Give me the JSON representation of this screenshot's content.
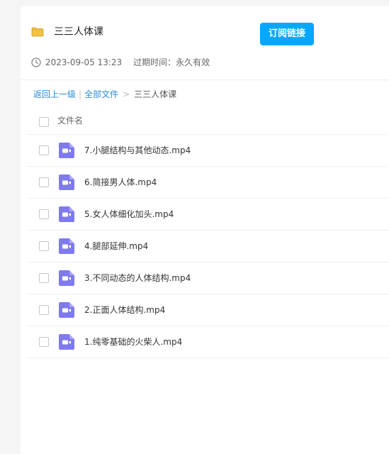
{
  "header": {
    "folder_icon": "folder-icon",
    "title": "三三人体课",
    "subscribe_label": "订阅链接",
    "subscribe_color": "#06a7ff",
    "date": "2023-09-05 13:23",
    "expiry": "过期时间：永久有效"
  },
  "breadcrumb": {
    "back_label": "返回上一级",
    "all_files_label": "全部文件",
    "current_label": "三三人体课"
  },
  "list": {
    "column_label": "文件名",
    "file_icon": "video-file-icon",
    "file_icon_color": "#7f79f2",
    "files": [
      {
        "name": "7.小腿结构与其他动态.mp4"
      },
      {
        "name": "6.简接男人体.mp4"
      },
      {
        "name": "5.女人体细化加头.mp4"
      },
      {
        "name": "4.腿部延伸.mp4"
      },
      {
        "name": "3.不同动态的人体结构.mp4"
      },
      {
        "name": "2.正面人体结构.mp4"
      },
      {
        "name": "1.纯零基础的火柴人.mp4"
      }
    ]
  }
}
